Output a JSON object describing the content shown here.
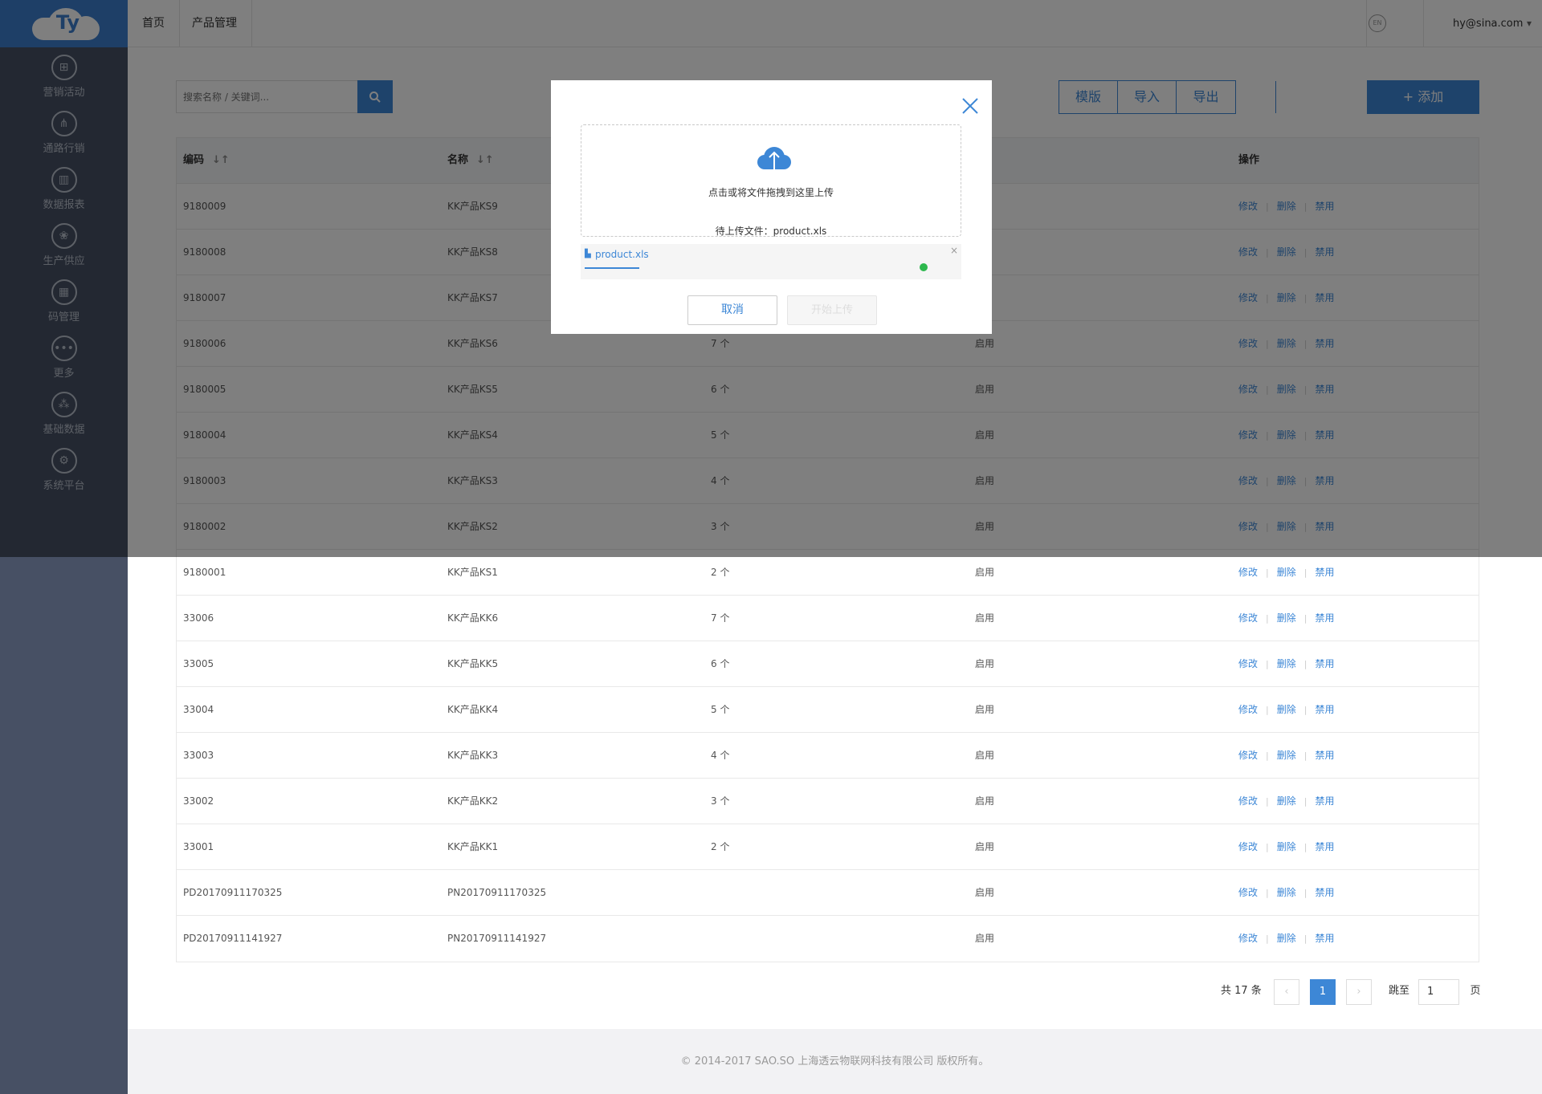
{
  "logo": {
    "text": "Ty"
  },
  "sidebar": {
    "items": [
      {
        "label": "营销活动",
        "icon": "bag-icon",
        "glyph": "⊞"
      },
      {
        "label": "通路行销",
        "icon": "network-icon",
        "glyph": "⋔"
      },
      {
        "label": "数据报表",
        "icon": "bar-chart-icon",
        "glyph": "▥"
      },
      {
        "label": "生产供应",
        "icon": "supply-icon",
        "glyph": "❀"
      },
      {
        "label": "码管理",
        "icon": "qrcode-icon",
        "glyph": "▦"
      },
      {
        "label": "更多",
        "icon": "more-icon",
        "glyph": "•••"
      },
      {
        "label": "基础数据",
        "icon": "hierarchy-icon",
        "glyph": "⁂"
      },
      {
        "label": "系统平台",
        "icon": "gear-icon",
        "glyph": "⚙"
      }
    ]
  },
  "topbar": {
    "tabs": [
      "首页",
      "产品管理"
    ],
    "lang": "EN",
    "user": "hy@sina.com",
    "user_caret": "▾"
  },
  "toolbar": {
    "search_placeholder": "搜索名称 / 关键词...",
    "buttons": [
      "模版",
      "导入",
      "导出"
    ],
    "add_label": "添加"
  },
  "table": {
    "headers": [
      "编码",
      "名称",
      "",
      "",
      "操作"
    ],
    "sort_glyph": "↓↑",
    "actions": [
      "修改",
      "删除",
      "禁用"
    ],
    "rows": [
      {
        "code": "9180009",
        "name": "KK产品KS9",
        "count": "",
        "status": ""
      },
      {
        "code": "9180008",
        "name": "KK产品KS8",
        "count": "",
        "status": ""
      },
      {
        "code": "9180007",
        "name": "KK产品KS7",
        "count": "",
        "status": ""
      },
      {
        "code": "9180006",
        "name": "KK产品KS6",
        "count": "7 个",
        "status": "启用"
      },
      {
        "code": "9180005",
        "name": "KK产品KS5",
        "count": "6 个",
        "status": "启用"
      },
      {
        "code": "9180004",
        "name": "KK产品KS4",
        "count": "5 个",
        "status": "启用"
      },
      {
        "code": "9180003",
        "name": "KK产品KS3",
        "count": "4 个",
        "status": "启用"
      },
      {
        "code": "9180002",
        "name": "KK产品KS2",
        "count": "3 个",
        "status": "启用"
      },
      {
        "code": "9180001",
        "name": "KK产品KS1",
        "count": "2 个",
        "status": "启用"
      },
      {
        "code": "33006",
        "name": "KK产品KK6",
        "count": "7 个",
        "status": "启用"
      },
      {
        "code": "33005",
        "name": "KK产品KK5",
        "count": "6 个",
        "status": "启用"
      },
      {
        "code": "33004",
        "name": "KK产品KK4",
        "count": "5 个",
        "status": "启用"
      },
      {
        "code": "33003",
        "name": "KK产品KK3",
        "count": "4 个",
        "status": "启用"
      },
      {
        "code": "33002",
        "name": "KK产品KK2",
        "count": "3 个",
        "status": "启用"
      },
      {
        "code": "33001",
        "name": "KK产品KK1",
        "count": "2 个",
        "status": "启用"
      },
      {
        "code": "PD20170911170325",
        "name": "PN20170911170325",
        "count": "",
        "status": "启用"
      },
      {
        "code": "PD20170911141927",
        "name": "PN20170911141927",
        "count": "",
        "status": "启用"
      }
    ]
  },
  "pagination": {
    "total_text": "共 17 条",
    "prev": "‹",
    "current": "1",
    "next": "›",
    "jump_label": "跳至",
    "jump_value": "1",
    "page_suffix": "页"
  },
  "footer": {
    "text": "© 2014-2017 SAO.SO 上海透云物联网科技有限公司 版权所有。"
  },
  "modal": {
    "drop_text": "点击或将文件拖拽到这里上传",
    "pending_text": "待上传文件：product.xls",
    "file_name": "product.xls",
    "file_remove": "×",
    "cancel_label": "取消",
    "submit_label": "开始上传"
  },
  "colors": {
    "accent": "#3d87d6",
    "sidebar_bg": "#475064",
    "logo_bg": "#3d7fce",
    "success": "#2db84d"
  }
}
